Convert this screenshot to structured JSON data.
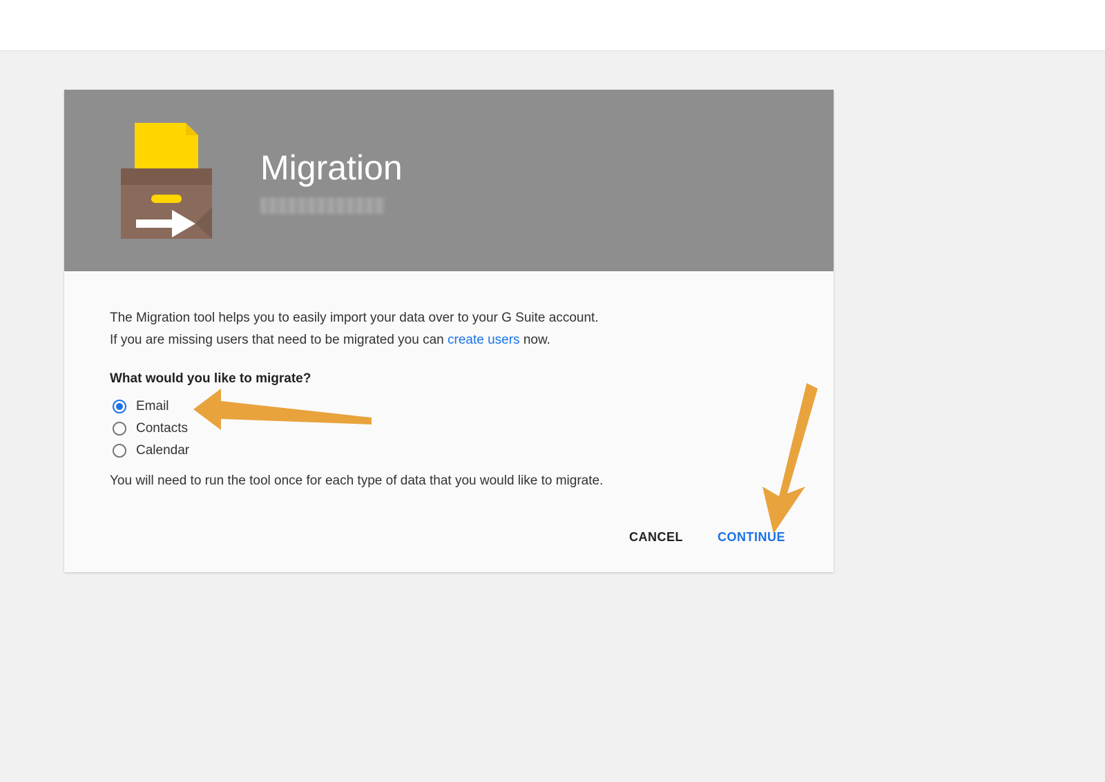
{
  "header": {
    "title": "Migration"
  },
  "content": {
    "intro1": "The Migration tool helps you to easily import your data over to your G Suite account.",
    "intro2_before": "If you are missing users that need to be migrated you can ",
    "intro2_link": "create users",
    "intro2_after": " now.",
    "question": "What would you like to migrate?",
    "options": [
      {
        "label": "Email",
        "selected": true
      },
      {
        "label": "Contacts",
        "selected": false
      },
      {
        "label": "Calendar",
        "selected": false
      }
    ],
    "note": "You will need to run the tool once for each type of data that you would like to migrate."
  },
  "actions": {
    "cancel": "CANCEL",
    "continue": "CONTINUE"
  },
  "colors": {
    "accent": "#1a73e8",
    "arrow": "#e8a33d"
  }
}
